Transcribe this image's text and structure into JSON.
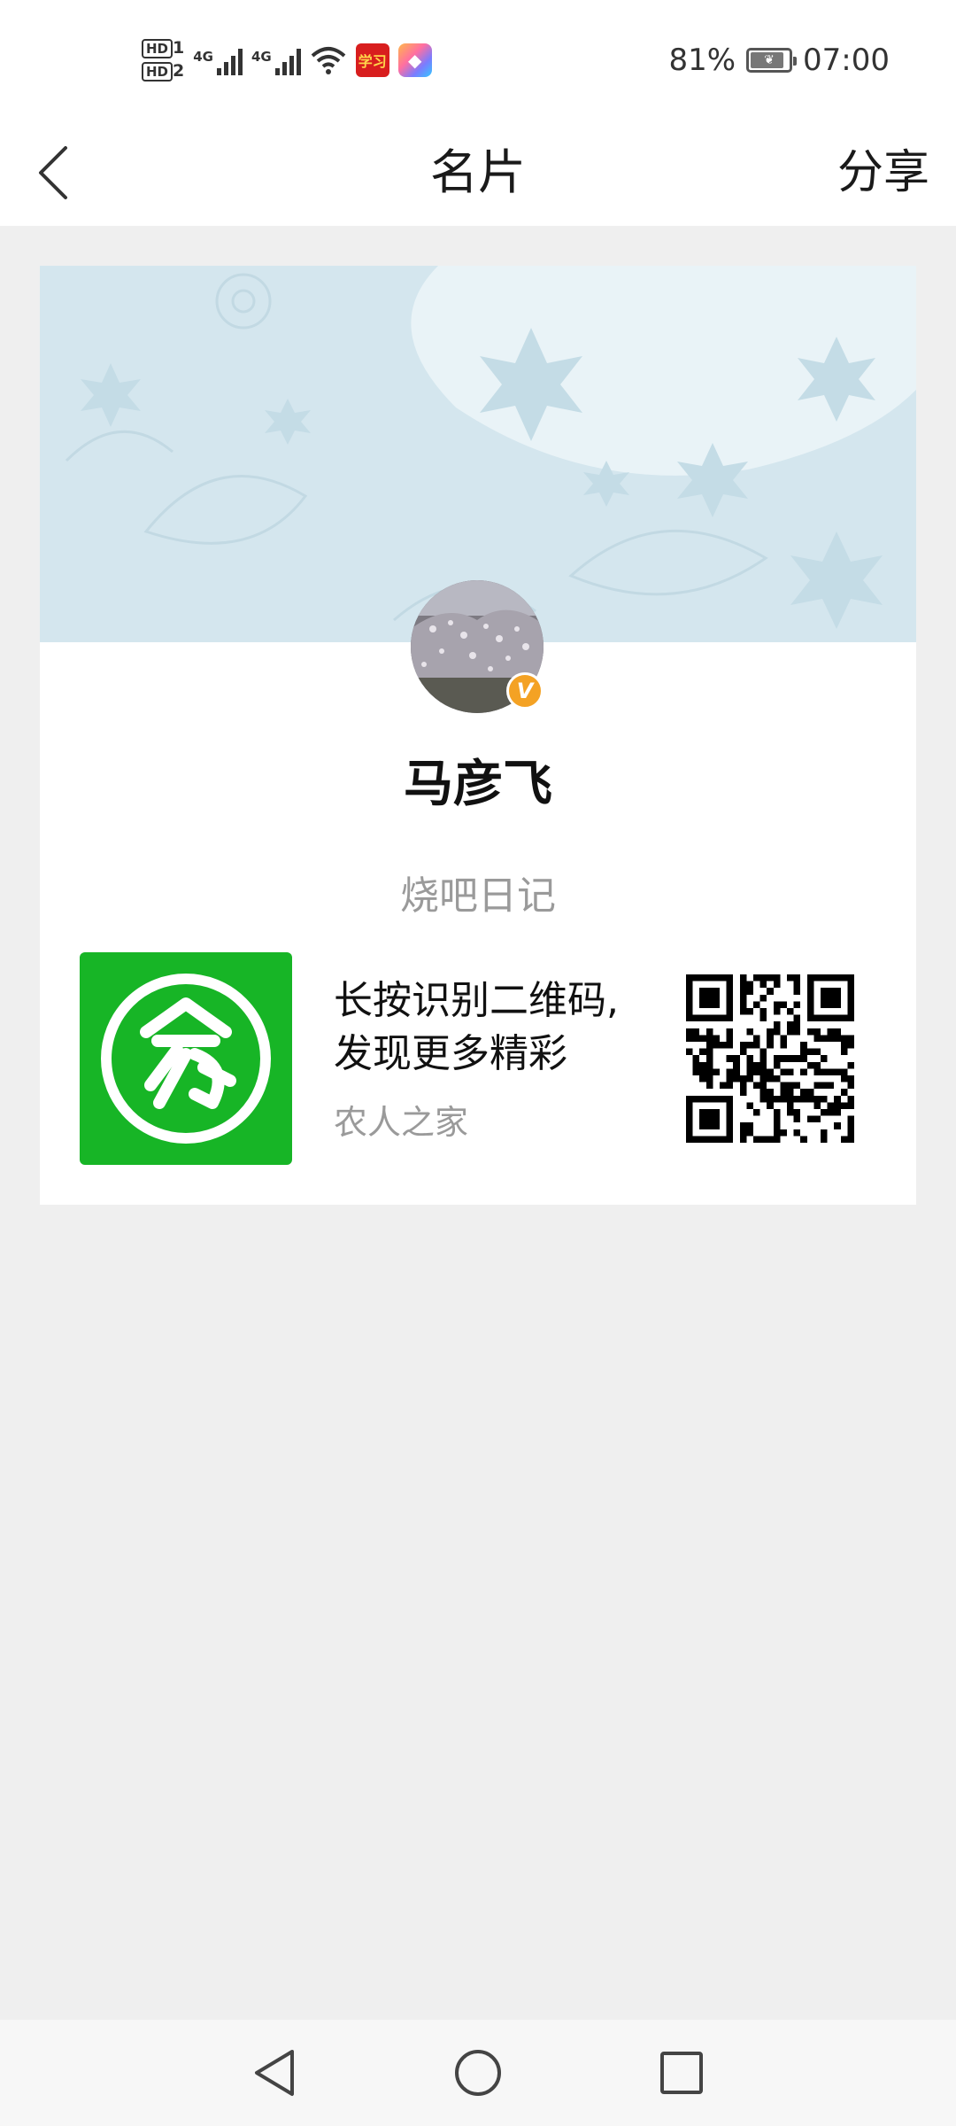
{
  "status_bar": {
    "hd1": "HD",
    "hd1_num": "1",
    "hd2": "HD",
    "hd2_num": "2",
    "network1": "4G",
    "network2": "4G",
    "app_icon_1_text": "学习",
    "battery_percent": "81%",
    "time": "07:00",
    "icons": [
      "signal-icon",
      "signal-icon",
      "wifi-icon",
      "xuexi-app-icon",
      "colorful-app-icon",
      "battery-icon"
    ]
  },
  "nav": {
    "title": "名片",
    "share_label": "分享",
    "back_icon": "chevron-left-icon"
  },
  "card": {
    "name": "马彦飞",
    "subtitle": "烧吧日记",
    "verified_badge": "V",
    "qr_prompt_line1": "长按识别二维码,",
    "qr_prompt_line2": "发现更多精彩",
    "qr_source": "农人之家",
    "logo_color": "#17b526",
    "badge_color": "#f4a224"
  },
  "system_nav": {
    "back_icon": "triangle-back-icon",
    "home_icon": "circle-home-icon",
    "recents_icon": "square-recents-icon"
  }
}
